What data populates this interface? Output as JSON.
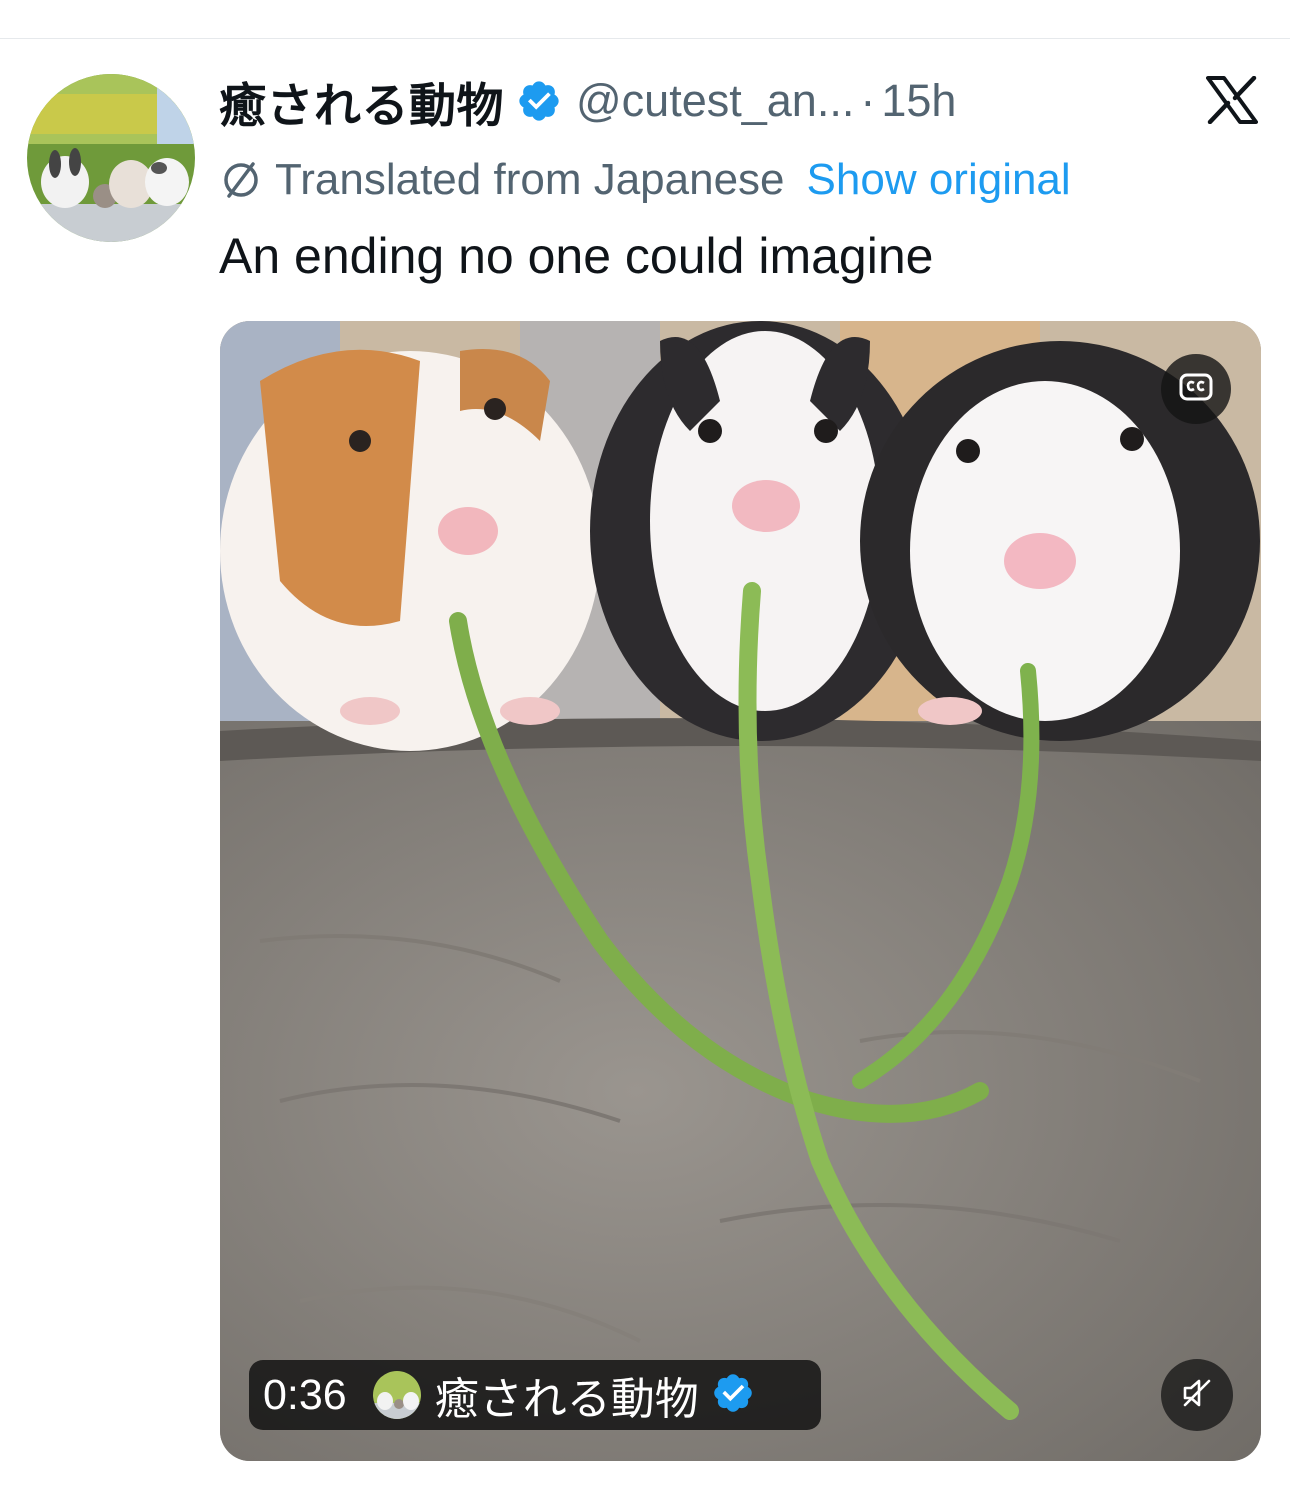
{
  "tweet": {
    "author": {
      "display_name": "癒される動物",
      "handle": "@cutest_an...",
      "verified": true
    },
    "separator": "·",
    "timestamp": "15h",
    "translation": {
      "label": "Translated from Japanese",
      "show_original": "Show original"
    },
    "text": "An ending no one could imagine",
    "media": {
      "duration": "0:36",
      "badge_name": "癒される動物"
    }
  },
  "colors": {
    "accent": "#1d9bf0",
    "secondary_text": "#536471",
    "primary_text": "#0f1419"
  },
  "icons": [
    "verified-badge-icon",
    "x-logo-icon",
    "translate-icon",
    "captions-icon",
    "mute-icon"
  ]
}
